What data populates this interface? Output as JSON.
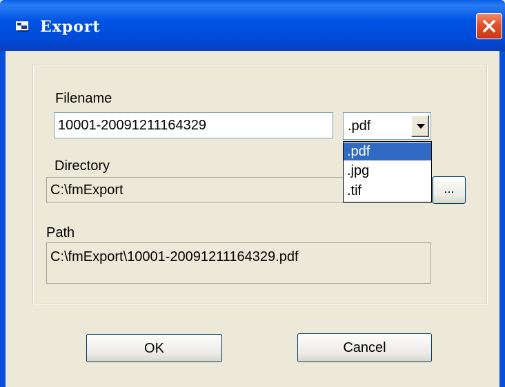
{
  "window": {
    "title": "Export",
    "close_icon": "close-icon",
    "colors": {
      "titlebar": "#0054e3",
      "close": "#e0512c",
      "face": "#ece9d8",
      "selection": "#316ac5"
    }
  },
  "form": {
    "filename": {
      "label": "Filename",
      "value": "10001-20091211164329"
    },
    "format": {
      "selected": ".pdf",
      "options": [
        ".pdf",
        ".jpg",
        ".tif"
      ],
      "highlighted": ".pdf"
    },
    "directory": {
      "label": "Directory",
      "value": "C:\\fmExport",
      "browse_label": "..."
    },
    "path": {
      "label": "Path",
      "value": "C:\\fmExport\\10001-20091211164329.pdf"
    }
  },
  "buttons": {
    "ok": "OK",
    "cancel": "Cancel"
  }
}
